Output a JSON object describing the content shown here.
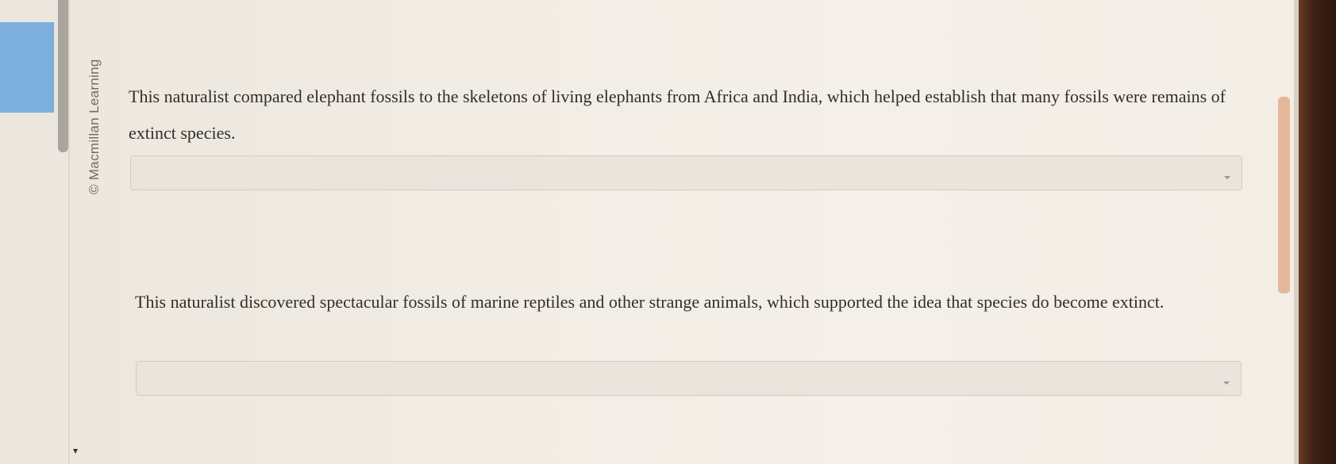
{
  "sidebar": {
    "credit": "© Macmillan Learning"
  },
  "questions": [
    {
      "text": "This naturalist compared elephant fossils to the skeletons of living elephants from Africa and India, which helped establish that many fossils were remains of extinct species.",
      "selected_value": ""
    },
    {
      "text": "This naturalist discovered spectacular fossils of marine reptiles and other strange animals, which supported the idea that species do become extinct.",
      "selected_value": ""
    }
  ],
  "icons": {
    "dropdown": "chevron-down-icon",
    "scroll": "scroll-down-arrow-icon"
  },
  "colors": {
    "highlight": "#7cafdb",
    "page_background": "#f1ece4",
    "dropdown_background": "#e9e4dc"
  }
}
